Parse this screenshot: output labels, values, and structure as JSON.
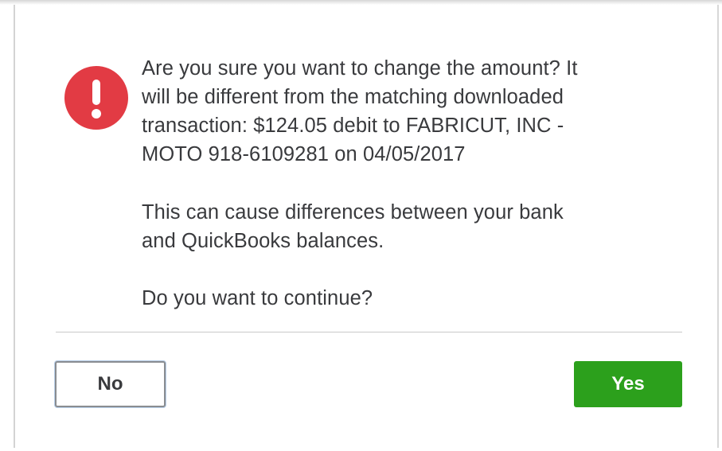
{
  "dialog": {
    "icon": "exclamation-alert-icon",
    "message_lines": [
      "Are you sure you want to change the amount? It",
      "will be different from the matching downloaded",
      "transaction: $124.05 debit to FABRICUT, INC -",
      "MOTO 918-6109281 on 04/05/2017"
    ],
    "warning_lines": [
      "This can cause differences between your bank",
      "and QuickBooks balances."
    ],
    "question": "Do you want to continue?",
    "no_label": "No",
    "yes_label": "Yes"
  },
  "colors": {
    "alert_red": "#e23b44",
    "yes_green": "#2ca01c",
    "text": "#393a3d"
  }
}
